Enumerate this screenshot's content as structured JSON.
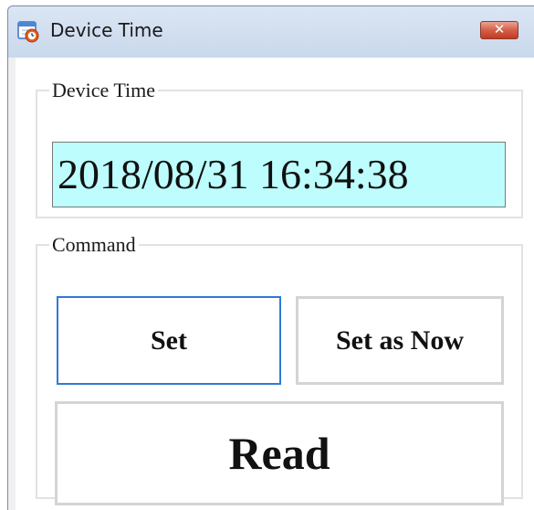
{
  "window": {
    "title": "Device Time",
    "close_label": "✕"
  },
  "device_time_group": {
    "legend": "Device Time",
    "value": "2018/08/31 16:34:38"
  },
  "command_group": {
    "legend": "Command",
    "set_label": "Set",
    "set_now_label": "Set as Now",
    "read_label": "Read"
  },
  "icons": {
    "app": "clock-calendar-icon",
    "close": "close-icon"
  },
  "colors": {
    "time_background": "#bdfdfd",
    "focused_button_border": "#2f7ad6",
    "close_button": "#c23b22"
  }
}
